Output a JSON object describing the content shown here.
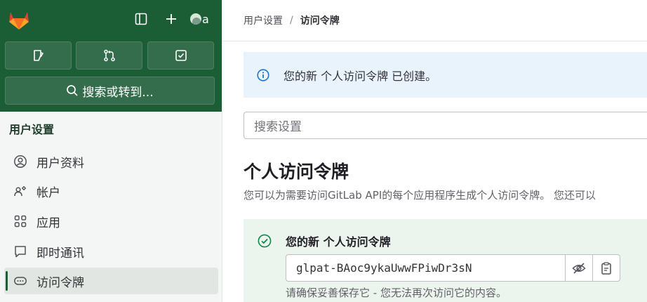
{
  "sidebar": {
    "avatar_letter": "a",
    "search_label": "搜索或转到...",
    "section_heading": "用户设置",
    "items": [
      {
        "label": "用户资料",
        "icon": "profile-icon"
      },
      {
        "label": "帐户",
        "icon": "account-icon"
      },
      {
        "label": "应用",
        "icon": "applications-icon"
      },
      {
        "label": "即时通讯",
        "icon": "chat-icon"
      },
      {
        "label": "访问令牌",
        "icon": "token-icon",
        "active": true
      }
    ]
  },
  "breadcrumb": {
    "parent": "用户设置",
    "separator": "/",
    "current": "访问令牌"
  },
  "alert": {
    "message": "您的新 个人访问令牌 已创建。"
  },
  "settings_search": {
    "placeholder": "搜索设置"
  },
  "section": {
    "title": "个人访问令牌",
    "description": "您可以为需要访问GitLab API的每个应用程序生成个人访问令牌。 您还可以"
  },
  "new_token": {
    "title": "您的新 个人访问令牌",
    "value": "glpat-BAoc9ykaUwwFPiwDr3sN",
    "warning": "请确保妥善保存它 - 您无法再次访问它的内容。"
  },
  "colors": {
    "sidebar_top": "#1b5e36",
    "alert_bg": "#e9f3fc",
    "success_bg": "#ecf4ee",
    "info_icon": "#1f75cb",
    "success_icon": "#108548"
  }
}
